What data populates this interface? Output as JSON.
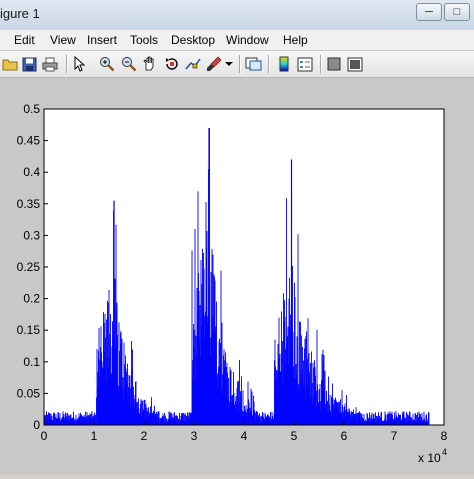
{
  "window": {
    "title": "igure 1",
    "minimize_icon": "minimize-icon",
    "maximize_icon": "maximize-icon"
  },
  "menu": {
    "items": [
      "Edit",
      "View",
      "Insert",
      "Tools",
      "Desktop",
      "Window",
      "Help"
    ]
  },
  "toolbar": {
    "tools": [
      "open-folder-icon",
      "save-icon",
      "print-icon",
      "pointer-icon",
      "zoom-in-icon",
      "zoom-out-icon",
      "pan-hand-icon",
      "rotate-3d-icon",
      "data-cursor-icon",
      "brush-icon",
      "dropdown-arrow-icon",
      "link-plot-icon",
      "colorbar-icon",
      "legend-icon",
      "hide-plot-tools-icon",
      "show-plot-tools-icon"
    ]
  },
  "chart_data": {
    "type": "bar",
    "title": "",
    "xlabel": "",
    "ylabel": "",
    "xlim": [
      0,
      8
    ],
    "ylim": [
      0,
      0.5
    ],
    "x_multiplier_label": "x 10",
    "x_multiplier_exponent": "4",
    "xticks": [
      "0",
      "1",
      "2",
      "3",
      "4",
      "5",
      "6",
      "7",
      "8"
    ],
    "yticks": [
      "0",
      "0.05",
      "0.1",
      "0.15",
      "0.2",
      "0.25",
      "0.3",
      "0.35",
      "0.4",
      "0.45",
      "0.5"
    ],
    "series": [
      {
        "color": "#0000ff",
        "x_range": [
          0.02,
          7.7
        ],
        "baseline_noise": 0.02,
        "bursts": [
          {
            "start": 1.05,
            "peak_x": 1.4,
            "peak": 0.355,
            "envelope": 0.25,
            "end": 2.3
          },
          {
            "start": 2.95,
            "peak_x": 3.3,
            "peak": 0.47,
            "envelope": 0.34,
            "end": 4.3
          },
          {
            "start": 4.6,
            "peak_x": 4.95,
            "peak": 0.42,
            "envelope": 0.27,
            "end": 6.3
          }
        ]
      }
    ]
  }
}
